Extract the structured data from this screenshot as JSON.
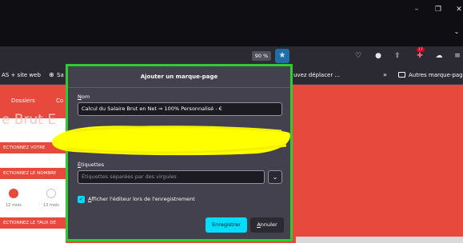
{
  "window_controls": {
    "minimize": "–",
    "maximize": "❐",
    "close": "✕"
  },
  "tabs_overflow_icon": "chevron-down-icon",
  "toolbar": {
    "zoom_level": "90 %",
    "bookmark_star_icon": "star-icon",
    "extension_badge": "17",
    "icons": [
      "pocket-icon",
      "account-icon",
      "share-icon",
      "extension-icon",
      "cloud-icon",
      "hamburger-menu-icon"
    ]
  },
  "bookmarks_bar": {
    "item1": "AS + site web",
    "item2": "Sa",
    "item3": "uvez déplacer ...",
    "overflow": "»",
    "other_bookmarks": "Autres marque-pages"
  },
  "page": {
    "tab_dossiers": "Dossiers",
    "tab_co": "Co",
    "heading_partial": "e Brut E",
    "section1": "ECTIONNEZ VOTRE",
    "section2": "ECTIONNEZ LE NOMBRE",
    "option1": "12 mois",
    "option2": "13 mois",
    "section3": "ECTIONNEZ LE TAUX DE"
  },
  "dialog": {
    "title": "Ajouter un marque-page",
    "name_label_accel": "N",
    "name_label_rest": "om",
    "name_value": "Calcul du Salaire Brut en Net ⇒ 100% Personnalisé - €",
    "tags_label_accel": "É",
    "tags_label_rest": "tiquettes",
    "tags_placeholder": "Étiquettes séparées par des virgules",
    "show_editor_accel": "A",
    "show_editor_rest": "fficher l'éditeur lors de l'enregistrement",
    "save_button": "Enregistrer",
    "cancel_accel": "A",
    "cancel_rest": "nnuler"
  },
  "colors": {
    "highlight_border": "#2ecc2e",
    "redaction": "#ffff00",
    "page_accent": "#e8493d",
    "primary_button": "#00ddff"
  }
}
